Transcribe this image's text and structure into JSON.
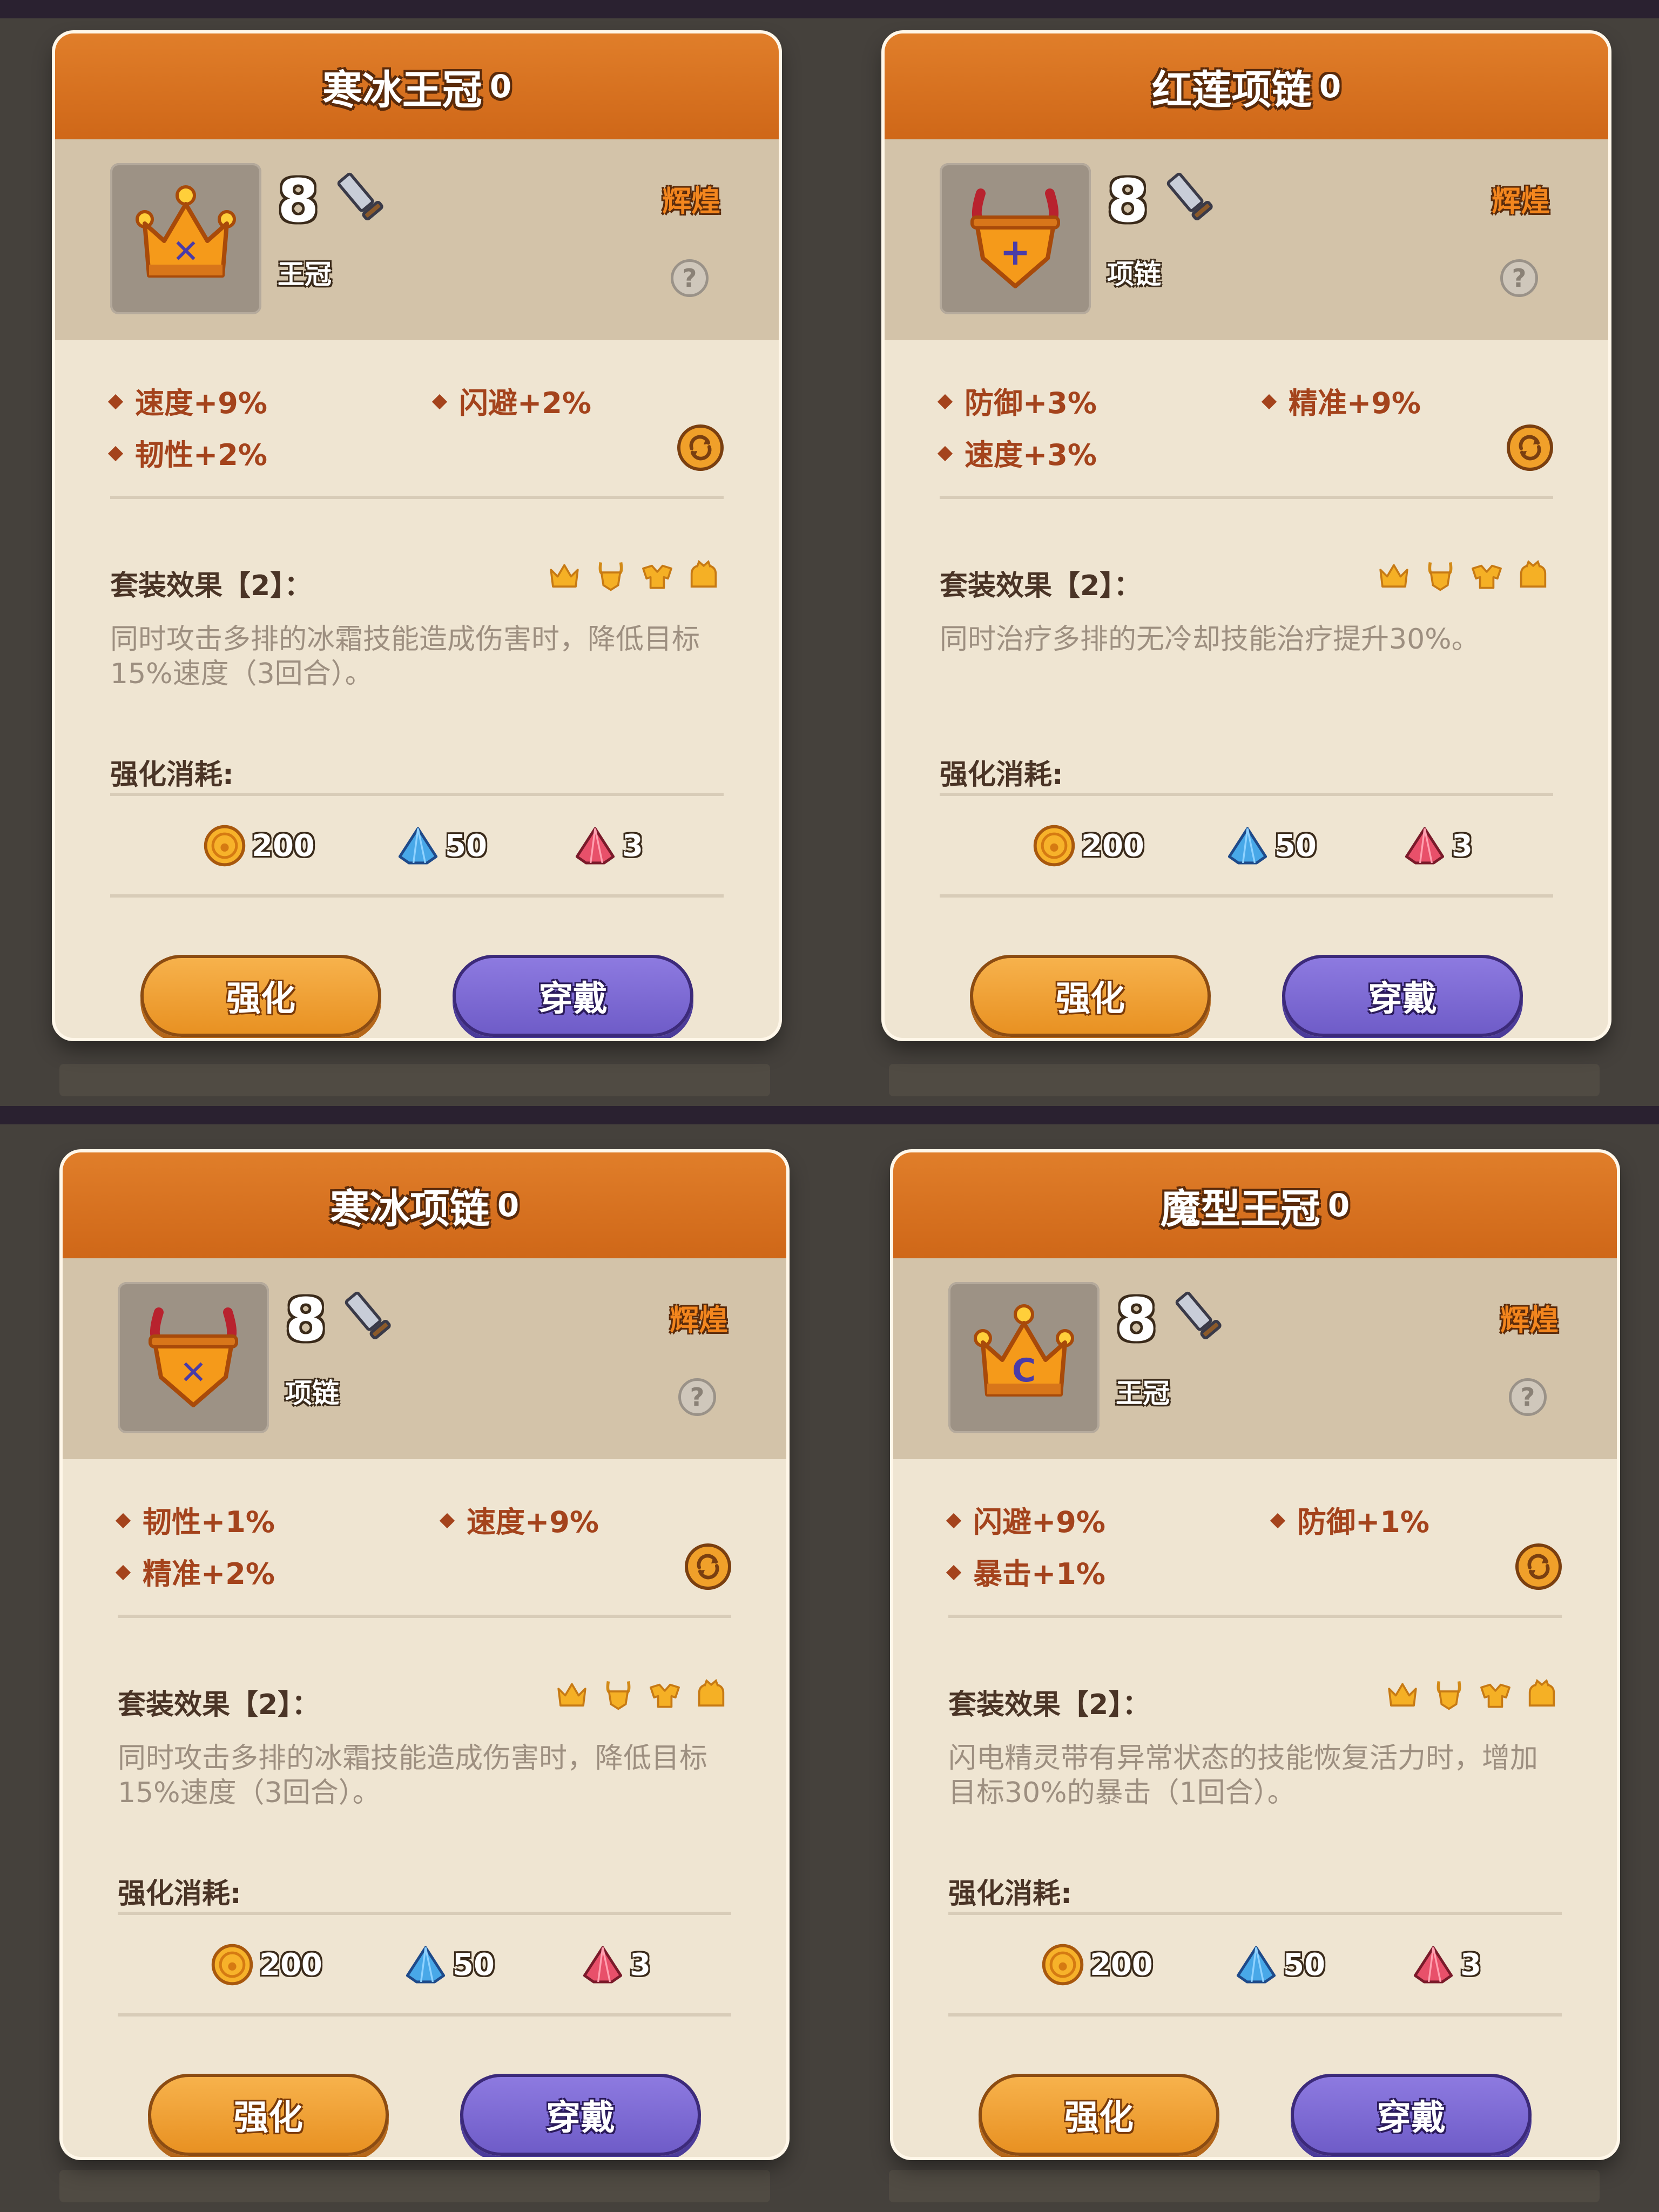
{
  "cards": [
    {
      "title": "寒冰王冠",
      "level_badge": "0",
      "item_level": "8",
      "type": "王冠",
      "rarity": "辉煌",
      "help": "?",
      "stats": [
        "速度+9%",
        "闪避+2%",
        "韧性+2%"
      ],
      "set_title": "套装效果【2】：",
      "set_desc": "同时攻击多排的冰霜技能造成伤害时，降低目标15%速度（3回合）。",
      "cost_title": "强化消耗:",
      "costs": [
        "200",
        "50",
        "3"
      ],
      "btn_upgrade": "强化",
      "btn_equip": "穿戴",
      "icon": "crown-icon",
      "emblem": "✕"
    },
    {
      "title": "红莲项链",
      "level_badge": "0",
      "item_level": "8",
      "type": "项链",
      "rarity": "辉煌",
      "help": "?",
      "stats": [
        "防御+3%",
        "精准+9%",
        "速度+3%"
      ],
      "set_title": "套装效果【2】：",
      "set_desc": "同时治疗多排的无冷却技能治疗提升30%。",
      "cost_title": "强化消耗:",
      "costs": [
        "200",
        "50",
        "3"
      ],
      "btn_upgrade": "强化",
      "btn_equip": "穿戴",
      "icon": "necklace-icon",
      "emblem": "+"
    },
    {
      "title": "寒冰项链",
      "level_badge": "0",
      "item_level": "8",
      "type": "项链",
      "rarity": "辉煌",
      "help": "?",
      "stats": [
        "韧性+1%",
        "速度+9%",
        "精准+2%"
      ],
      "set_title": "套装效果【2】：",
      "set_desc": "同时攻击多排的冰霜技能造成伤害时，降低目标15%速度（3回合）。",
      "cost_title": "强化消耗:",
      "costs": [
        "200",
        "50",
        "3"
      ],
      "btn_upgrade": "强化",
      "btn_equip": "穿戴",
      "icon": "necklace-icon",
      "emblem": "✕"
    },
    {
      "title": "魔型王冠",
      "level_badge": "0",
      "item_level": "8",
      "type": "王冠",
      "rarity": "辉煌",
      "help": "?",
      "stats": [
        "闪避+9%",
        "防御+1%",
        "暴击+1%"
      ],
      "set_title": "套装效果【2】：",
      "set_desc": "闪电精灵带有异常状态的技能恢复活力时，增加目标30%的暴击（1回合）。",
      "cost_title": "强化消耗:",
      "costs": [
        "200",
        "50",
        "3"
      ],
      "btn_upgrade": "强化",
      "btn_equip": "穿戴",
      "icon": "crown-icon",
      "emblem": "C"
    }
  ],
  "colors": {
    "header": "#d9711f",
    "info_band": "#d3c3a9",
    "body": "#efe5d2",
    "stat_text": "#a4431c",
    "desc_text": "#9d8f80",
    "rarity": "#f3861e",
    "upgrade_btn": "#f0a03a",
    "equip_btn": "#7c68d4"
  }
}
